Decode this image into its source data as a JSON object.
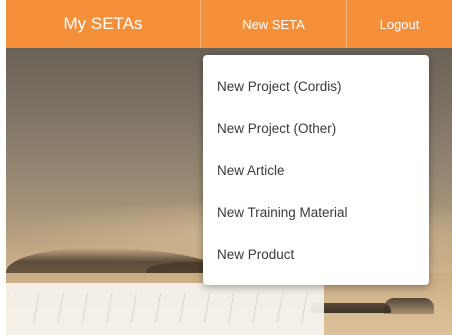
{
  "navbar": {
    "home_label": "My SETAs",
    "new_label": "New SETA",
    "logout_label": "Logout",
    "background_color": "#f58f3a"
  },
  "dropdown": {
    "items": [
      {
        "label": "New Project (Cordis)"
      },
      {
        "label": "New Project (Other)"
      },
      {
        "label": "New Article"
      },
      {
        "label": "New Training Material"
      },
      {
        "label": "New Product"
      }
    ]
  }
}
